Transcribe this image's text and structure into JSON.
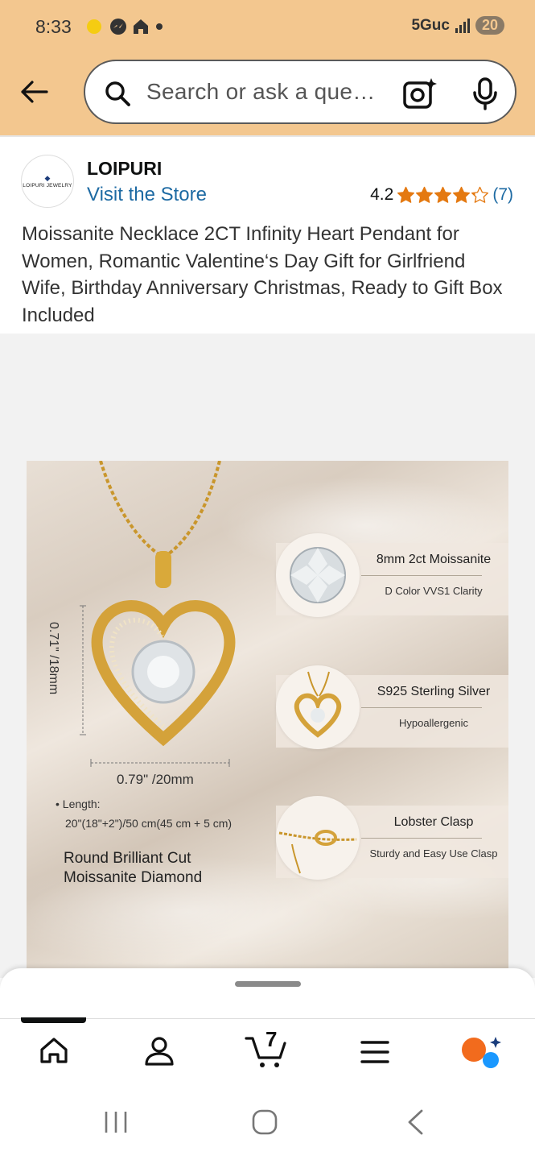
{
  "status": {
    "time": "8:33",
    "network": "5Guc",
    "battery": "20"
  },
  "search": {
    "placeholder": "Search or ask a que…"
  },
  "store": {
    "logo_text": "LOIPURI JEWELRY",
    "brand": "LOIPURI",
    "visit_label": "Visit the Store",
    "rating": "4.2",
    "review_count": "(7)",
    "stars_value": 4.2
  },
  "product": {
    "title": "Moissanite Necklace 2CT Infinity Heart Pendant for Women, Romantic Valentine‘s Day Gift for Girlfriend Wife, Birthday Anniversary Christmas, Ready to Gift Box Included",
    "image": {
      "dim_vertical": "0.71\" /18mm",
      "dim_horizontal": "0.79\" /20mm",
      "length_label": "Length:",
      "length_value": "20\"(18\"+2\")/50 cm(45 cm + 5 cm)",
      "cut_line1": "Round Brilliant Cut",
      "cut_line2": "Moissanite Diamond",
      "features": [
        {
          "title": "8mm 2ct Moissanite",
          "subtitle": "D Color VVS1 Clarity"
        },
        {
          "title": "S925 Sterling Silver",
          "subtitle": "Hypoallergenic"
        },
        {
          "title": "Lobster Clasp",
          "subtitle": "Sturdy and Easy Use Clasp"
        }
      ]
    }
  },
  "tabs": {
    "cart_count": "7"
  },
  "colors": {
    "header": "#f3c78f",
    "link": "#1d6aa3",
    "star": "#e47911"
  }
}
